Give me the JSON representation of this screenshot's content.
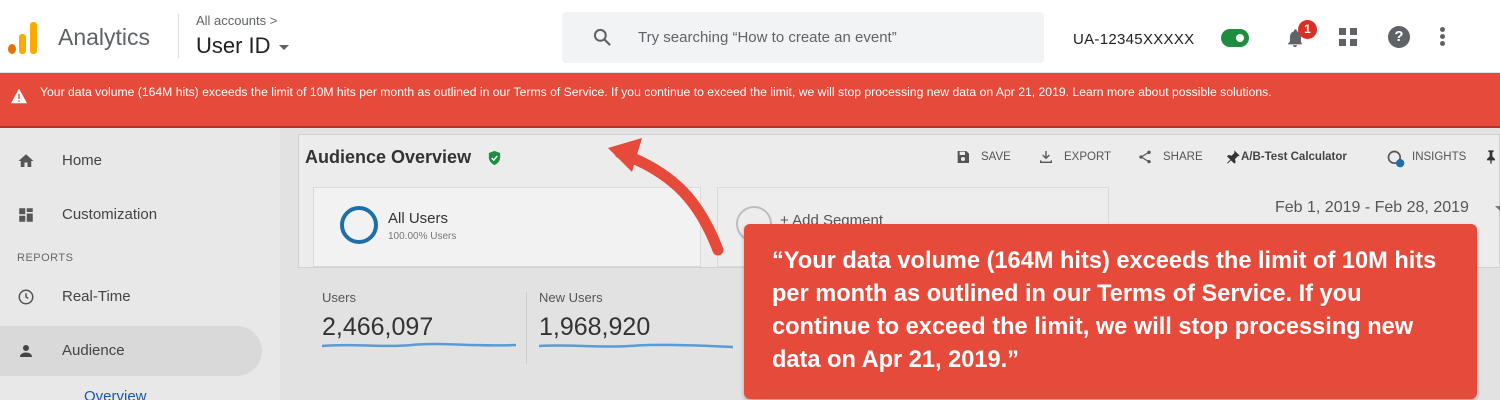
{
  "topbar": {
    "app_name": "Analytics",
    "accounts_label": "All accounts >",
    "property_name": "User ID",
    "search_placeholder": "Try searching “How to create an event”",
    "tracking_id": "UA-12345XXXXX",
    "notification_count": "1",
    "help_glyph": "?",
    "icons": [
      "analytics-logo",
      "search-icon",
      "toggle-switch",
      "bell-icon",
      "apps-grid-icon",
      "help-icon",
      "more-vert-icon"
    ]
  },
  "alert": {
    "text": "Your data volume (164M hits) exceeds the limit of 10M hits per month as outlined in our Terms of Service. If you continue to exceed the limit, we will stop processing new data on Apr 21, 2019. Learn more about possible solutions.",
    "icon": "warning-icon",
    "color": "#e64a3b"
  },
  "sidebar": {
    "items": [
      {
        "label": "Home",
        "icon": "home-icon"
      },
      {
        "label": "Customization",
        "icon": "dashboard-icon"
      },
      {
        "label": "Real-Time",
        "icon": "clock-icon"
      },
      {
        "label": "Audience",
        "icon": "person-icon"
      }
    ],
    "section_label": "REPORTS",
    "sub_item": "Overview"
  },
  "report": {
    "title": "Audience Overview",
    "tools": [
      "SAVE",
      "EXPORT",
      "SHARE",
      "A/B-Test Calculator",
      "INSIGHTS"
    ],
    "segment": {
      "name": "All Users",
      "sub": "100.00% Users"
    },
    "add_segment": "+ Add Segment",
    "date_range": "Feb 1, 2019 - Feb 28, 2019"
  },
  "metrics": [
    {
      "label": "Users",
      "value": "2,466,097"
    },
    {
      "label": "New Users",
      "value": "1,968,920"
    }
  ],
  "callout": {
    "text": "“Your data volume (164M hits) exceeds the limit of 10M hits per month as outlined in our Terms of Service. If you continue to exceed the limit, we will stop processing new data on Apr 21, 2019.”",
    "color": "#e64a3b"
  }
}
